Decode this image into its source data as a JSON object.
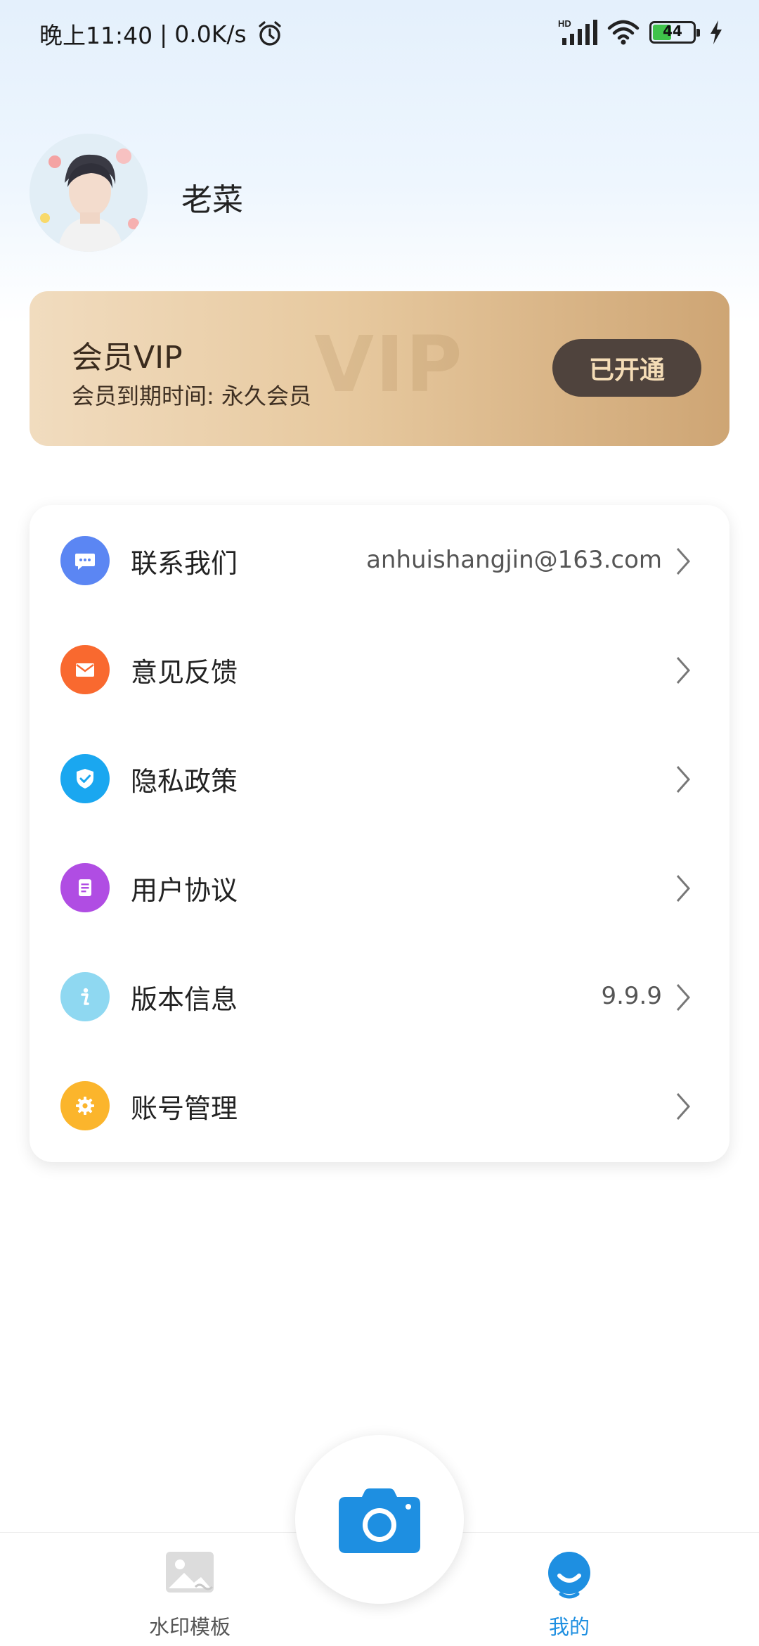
{
  "status_bar": {
    "time": "晚上11:40",
    "separator": "|",
    "net_speed": "0.0K/s",
    "battery_level": "44",
    "network_badge": "HD"
  },
  "profile": {
    "username": "老菜"
  },
  "vip": {
    "title": "会员VIP",
    "watermark": "VIP",
    "expire_label": "会员到期时间: 永久会员",
    "button": "已开通"
  },
  "menu": {
    "items": [
      {
        "label": "联系我们",
        "value": "anhuishangjin@163.com",
        "icon": "chat-icon",
        "color": "#5b86f3"
      },
      {
        "label": "意见反馈",
        "value": "",
        "icon": "mail-icon",
        "color": "#f9692f"
      },
      {
        "label": "隐私政策",
        "value": "",
        "icon": "shield-icon",
        "color": "#1aa7f0"
      },
      {
        "label": "用户协议",
        "value": "",
        "icon": "document-icon",
        "color": "#b04de3"
      },
      {
        "label": "版本信息",
        "value": "9.9.9",
        "icon": "info-icon",
        "color": "#8fd8f1"
      },
      {
        "label": "账号管理",
        "value": "",
        "icon": "gear-icon",
        "color": "#fbb52c"
      }
    ]
  },
  "bottom_nav": {
    "left_label": "水印模板",
    "right_label": "我的",
    "active_color": "#1e8fe1",
    "inactive_color": "#555555"
  }
}
